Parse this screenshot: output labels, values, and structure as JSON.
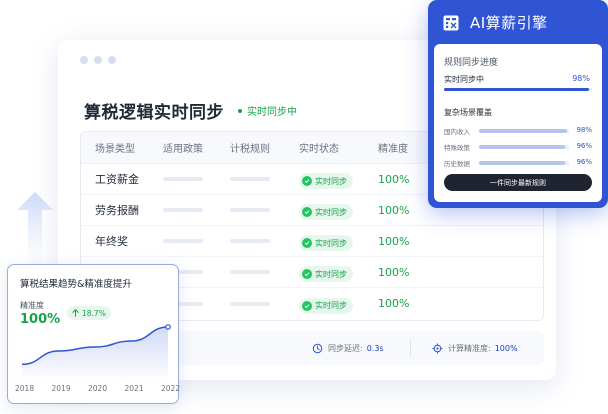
{
  "main": {
    "title": "算税逻辑实时同步",
    "status_tag": "实时同步中",
    "table": {
      "headers": [
        "场景类型",
        "适用政策",
        "计税规则",
        "实时状态",
        "精准度"
      ],
      "rows": [
        {
          "scene": "工资薪金",
          "status": "实时同步",
          "accuracy": "100%"
        },
        {
          "scene": "劳务报酬",
          "status": "实时同步",
          "accuracy": "100%"
        },
        {
          "scene": "年终奖",
          "status": "实时同步",
          "accuracy": "100%"
        },
        {
          "scene": "",
          "status": "实时同步",
          "accuracy": "100%"
        },
        {
          "scene": "",
          "status": "实时同步",
          "accuracy": "100%"
        }
      ]
    },
    "footer": {
      "latency_label": "同步延迟:",
      "latency_value": "0.3s",
      "precision_label": "计算精准度:",
      "precision_value": "100%"
    }
  },
  "trend_card": {
    "title": "算税结果趋势&精准度提升",
    "metric_label": "精准度",
    "metric_value": "100%",
    "delta": "18.7%"
  },
  "chart_data": {
    "type": "area",
    "x": [
      "2018",
      "2019",
      "2020",
      "2021",
      "2022"
    ],
    "series": [
      {
        "values": [
          81.3,
          88,
          90,
          93,
          100
        ]
      }
    ],
    "ylim": [
      75,
      105
    ],
    "grid": false,
    "accent": "#2f55d4"
  },
  "ai_panel": {
    "title": "AI算薪引擎",
    "section_title": "规则同步进度",
    "sync_label": "实时同步中",
    "sync_percent": "98%",
    "sync_progress": 0.98,
    "coverage_title": "复杂场景覆盖",
    "coverage": [
      {
        "name": "国内收入",
        "percent": "98%",
        "value": 0.98
      },
      {
        "name": "特殊政策",
        "percent": "96%",
        "value": 0.96
      },
      {
        "name": "历史数据",
        "percent": "96%",
        "value": 0.96
      }
    ],
    "button_label": "一件同步最新规则"
  },
  "colors": {
    "brand": "#2f55d4",
    "success": "#16a34a",
    "dark_button": "#1f2430"
  }
}
